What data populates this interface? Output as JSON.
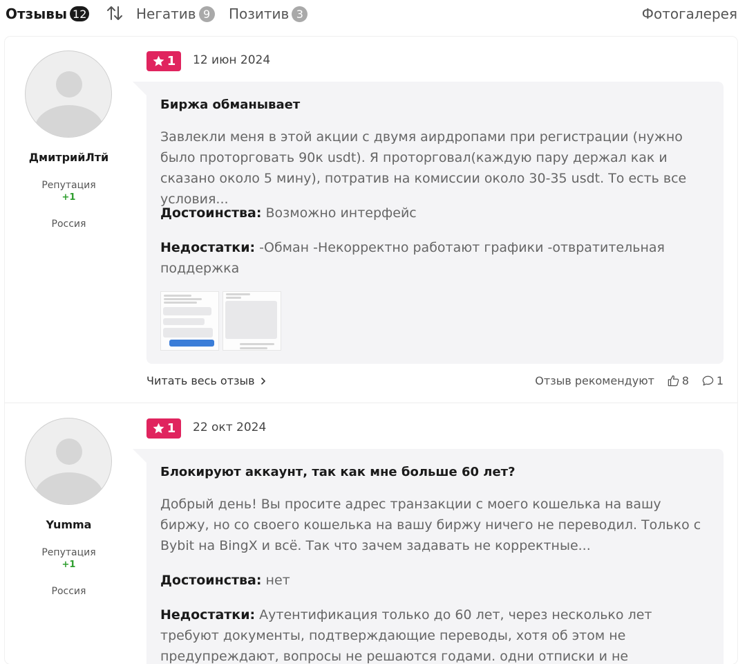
{
  "tabs": {
    "all_label": "Отзывы",
    "all_count": "12",
    "negative_label": "Негатив",
    "negative_count": "9",
    "positive_label": "Позитив",
    "positive_count": "3",
    "gallery_label": "Фотогалерея",
    "sort_icon": "sort-arrows-icon"
  },
  "colors": {
    "rating_badge": "#e0245e",
    "reputation_positive": "#2e9e2e",
    "bubble_bg": "#f4f4f6"
  },
  "reviews": [
    {
      "author": "ДмитрийЛтй",
      "reputation_label": "Репутация",
      "reputation_value": "+1",
      "country": "Россия",
      "rating": "1",
      "date": "12 июн 2024",
      "title": "Биржа обманывает",
      "text": "Завлекли меня в этой акции с двумя аирдропами при регистрации (нужно было проторговать 90к usdt). Я проторговал(каждую пару держал как и сказано около 5 мину), потратив на комиссии около 30-35 usdt. То есть все условия...",
      "pros_label": "Достоинства:",
      "pros": "Возможно интерфейс",
      "cons_label": "Недостатки:",
      "cons": "-Обман -Некорректно работают графики -отвратительная поддержка",
      "read_more": "Читать весь отзыв",
      "recommend_label": "Отзыв рекомендуют",
      "likes": "8",
      "comments": "1"
    },
    {
      "author": "Yumma",
      "reputation_label": "Репутация",
      "reputation_value": "+1",
      "country": "Россия",
      "rating": "1",
      "date": "22 окт 2024",
      "title": "Блокируют аккаунт, так как мне больше 60 лет?",
      "text": "Добрый день! Вы просите адрес транзакции с моего кошелька на вашу биржу, но со своего кошелька на вашу биржу ничего не переводил. Только с Bybit на BingX и всё. Так что зачем задавать не корректные...",
      "pros_label": "Достоинства:",
      "pros": "нет",
      "cons_label": "Недостатки:",
      "cons": "Аутентификация только до 60 лет, через несколько лет требуют документы, подтверждающие переводы, хотя об этом не предупреждают, вопросы не решаются годами. одни отписки и не выполнимые требования."
    }
  ]
}
